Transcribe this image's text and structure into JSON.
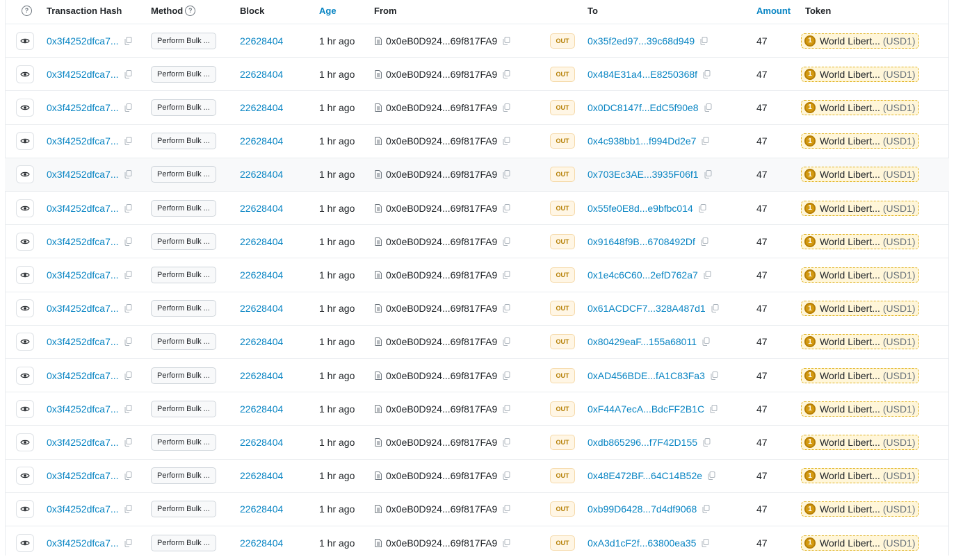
{
  "columns": {
    "help": "?",
    "tx_hash": "Transaction Hash",
    "method": "Method",
    "method_help": "?",
    "block": "Block",
    "age": "Age",
    "from": "From",
    "to": "To",
    "amount": "Amount",
    "token": "Token"
  },
  "colors": {
    "link": "#0784c3",
    "out": "#b47d00",
    "token_border": "#e0b21f"
  },
  "rows": [
    {
      "tx": "0x3f4252dfca7...",
      "method": "Perform Bulk ...",
      "block": "22628404",
      "age": "1 hr ago",
      "from": "0x0eB0D924...69f817FA9",
      "dir": "OUT",
      "to": "0x35f2ed97...39c68d949",
      "amount": "47",
      "token_name": "World Libert...",
      "token_symbol": "(USD1)"
    },
    {
      "tx": "0x3f4252dfca7...",
      "method": "Perform Bulk ...",
      "block": "22628404",
      "age": "1 hr ago",
      "from": "0x0eB0D924...69f817FA9",
      "dir": "OUT",
      "to": "0x484E31a4...E8250368f",
      "amount": "47",
      "token_name": "World Libert...",
      "token_symbol": "(USD1)"
    },
    {
      "tx": "0x3f4252dfca7...",
      "method": "Perform Bulk ...",
      "block": "22628404",
      "age": "1 hr ago",
      "from": "0x0eB0D924...69f817FA9",
      "dir": "OUT",
      "to": "0x0DC8147f...EdC5f90e8",
      "amount": "47",
      "token_name": "World Libert...",
      "token_symbol": "(USD1)"
    },
    {
      "tx": "0x3f4252dfca7...",
      "method": "Perform Bulk ...",
      "block": "22628404",
      "age": "1 hr ago",
      "from": "0x0eB0D924...69f817FA9",
      "dir": "OUT",
      "to": "0x4c938bb1...f994Dd2e7",
      "amount": "47",
      "token_name": "World Libert...",
      "token_symbol": "(USD1)"
    },
    {
      "tx": "0x3f4252dfca7...",
      "method": "Perform Bulk ...",
      "block": "22628404",
      "age": "1 hr ago",
      "from": "0x0eB0D924...69f817FA9",
      "dir": "OUT",
      "to": "0x703Ec3AE...3935F06f1",
      "amount": "47",
      "token_name": "World Libert...",
      "token_symbol": "(USD1)"
    },
    {
      "tx": "0x3f4252dfca7...",
      "method": "Perform Bulk ...",
      "block": "22628404",
      "age": "1 hr ago",
      "from": "0x0eB0D924...69f817FA9",
      "dir": "OUT",
      "to": "0x55fe0E8d...e9bfbc014",
      "amount": "47",
      "token_name": "World Libert...",
      "token_symbol": "(USD1)"
    },
    {
      "tx": "0x3f4252dfca7...",
      "method": "Perform Bulk ...",
      "block": "22628404",
      "age": "1 hr ago",
      "from": "0x0eB0D924...69f817FA9",
      "dir": "OUT",
      "to": "0x91648f9B...6708492Df",
      "amount": "47",
      "token_name": "World Libert...",
      "token_symbol": "(USD1)"
    },
    {
      "tx": "0x3f4252dfca7...",
      "method": "Perform Bulk ...",
      "block": "22628404",
      "age": "1 hr ago",
      "from": "0x0eB0D924...69f817FA9",
      "dir": "OUT",
      "to": "0x1e4c6C60...2efD762a7",
      "amount": "47",
      "token_name": "World Libert...",
      "token_symbol": "(USD1)"
    },
    {
      "tx": "0x3f4252dfca7...",
      "method": "Perform Bulk ...",
      "block": "22628404",
      "age": "1 hr ago",
      "from": "0x0eB0D924...69f817FA9",
      "dir": "OUT",
      "to": "0x61ACDCF7...328A487d1",
      "amount": "47",
      "token_name": "World Libert...",
      "token_symbol": "(USD1)"
    },
    {
      "tx": "0x3f4252dfca7...",
      "method": "Perform Bulk ...",
      "block": "22628404",
      "age": "1 hr ago",
      "from": "0x0eB0D924...69f817FA9",
      "dir": "OUT",
      "to": "0x80429eaF...155a68011",
      "amount": "47",
      "token_name": "World Libert...",
      "token_symbol": "(USD1)"
    },
    {
      "tx": "0x3f4252dfca7...",
      "method": "Perform Bulk ...",
      "block": "22628404",
      "age": "1 hr ago",
      "from": "0x0eB0D924...69f817FA9",
      "dir": "OUT",
      "to": "0xAD456BDE...fA1C83Fa3",
      "amount": "47",
      "token_name": "World Libert...",
      "token_symbol": "(USD1)"
    },
    {
      "tx": "0x3f4252dfca7...",
      "method": "Perform Bulk ...",
      "block": "22628404",
      "age": "1 hr ago",
      "from": "0x0eB0D924...69f817FA9",
      "dir": "OUT",
      "to": "0xF44A7ecA...BdcFF2B1C",
      "amount": "47",
      "token_name": "World Libert...",
      "token_symbol": "(USD1)"
    },
    {
      "tx": "0x3f4252dfca7...",
      "method": "Perform Bulk ...",
      "block": "22628404",
      "age": "1 hr ago",
      "from": "0x0eB0D924...69f817FA9",
      "dir": "OUT",
      "to": "0xdb865296...f7F42D155",
      "amount": "47",
      "token_name": "World Libert...",
      "token_symbol": "(USD1)"
    },
    {
      "tx": "0x3f4252dfca7...",
      "method": "Perform Bulk ...",
      "block": "22628404",
      "age": "1 hr ago",
      "from": "0x0eB0D924...69f817FA9",
      "dir": "OUT",
      "to": "0x48E472BF...64C14B52e",
      "amount": "47",
      "token_name": "World Libert...",
      "token_symbol": "(USD1)"
    },
    {
      "tx": "0x3f4252dfca7...",
      "method": "Perform Bulk ...",
      "block": "22628404",
      "age": "1 hr ago",
      "from": "0x0eB0D924...69f817FA9",
      "dir": "OUT",
      "to": "0xb99D6428...7d4df9068",
      "amount": "47",
      "token_name": "World Libert...",
      "token_symbol": "(USD1)"
    },
    {
      "tx": "0x3f4252dfca7...",
      "method": "Perform Bulk ...",
      "block": "22628404",
      "age": "1 hr ago",
      "from": "0x0eB0D924...69f817FA9",
      "dir": "OUT",
      "to": "0xA3d1cF2f...63800ea35",
      "amount": "47",
      "token_name": "World Libert...",
      "token_symbol": "(USD1)"
    }
  ]
}
